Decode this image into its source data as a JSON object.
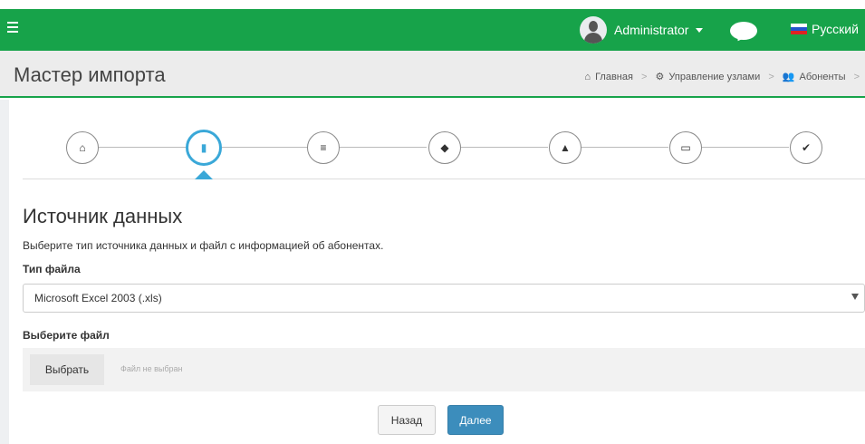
{
  "header": {
    "user_name": "Administrator",
    "language": "Русский",
    "brand_color": "#17a34a"
  },
  "title_bar": {
    "page_title": "Мастер импорта",
    "breadcrumb": [
      "Главная",
      "Управление узлами",
      "Абоненты"
    ]
  },
  "wizard": {
    "steps": [
      {
        "icon": "home-icon",
        "glyph": "⌂",
        "active": false
      },
      {
        "icon": "file-icon",
        "glyph": "▮",
        "active": true
      },
      {
        "icon": "list-icon",
        "glyph": "≡",
        "active": false
      },
      {
        "icon": "tag-icon",
        "glyph": "◆",
        "active": false
      },
      {
        "icon": "lock-icon",
        "glyph": "▲",
        "active": false
      },
      {
        "icon": "laptop-icon",
        "glyph": "▭",
        "active": false
      },
      {
        "icon": "check-icon",
        "glyph": "✔",
        "active": false
      }
    ]
  },
  "form": {
    "section_title": "Источник данных",
    "description": "Выберите тип источника данных и файл с информацией об абонентах.",
    "file_type_label": "Тип файла",
    "file_type_value": "Microsoft Excel 2003 (.xls)",
    "choose_file_label": "Выберите файл",
    "choose_button": "Выбрать",
    "no_file_text": "Файл не выбран"
  },
  "actions": {
    "back_label": "Назад",
    "next_label": "Далее"
  }
}
